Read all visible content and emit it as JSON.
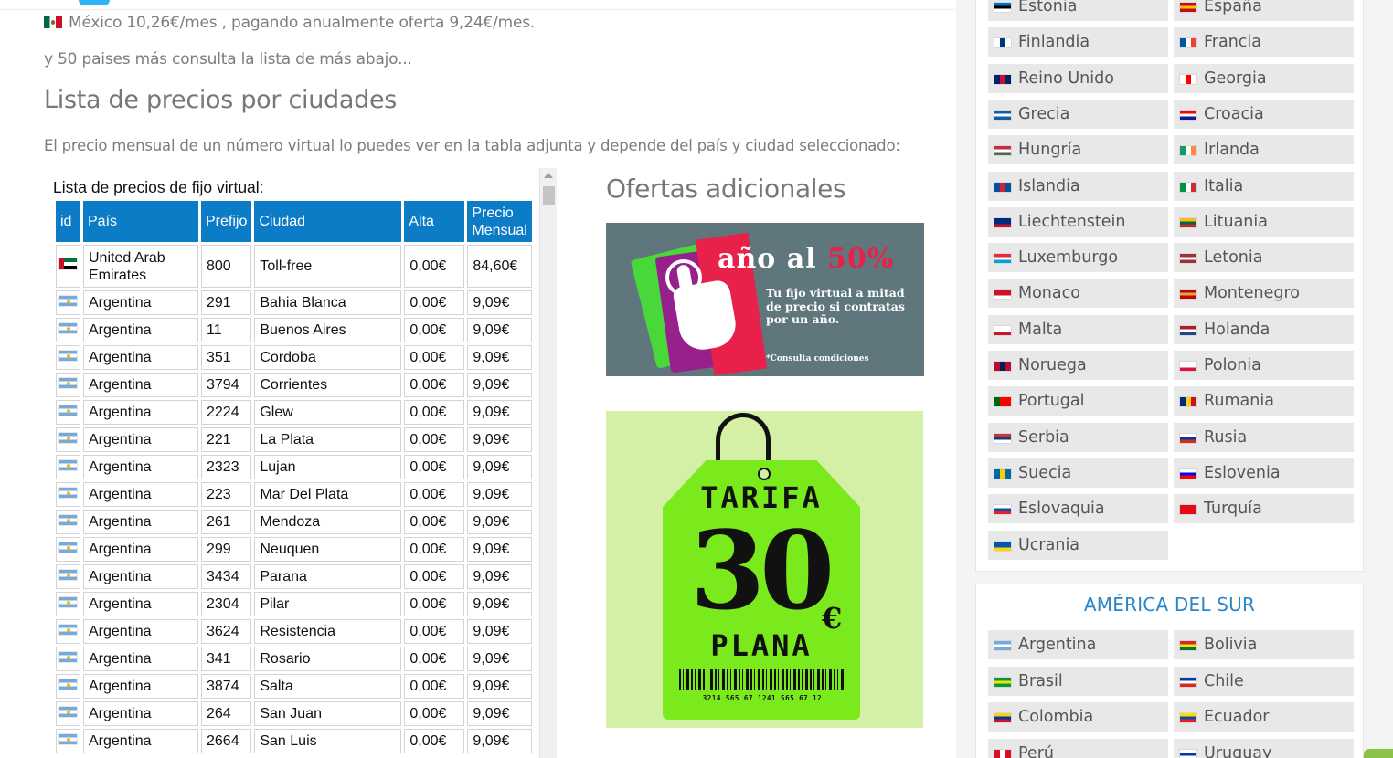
{
  "intro": {
    "mexico_line": "México 10,26€/mes , pagando anualmente oferta 9,24€/mes.",
    "more_countries": "y 50 paises más consulta la lista de más abajo..."
  },
  "section": {
    "title": "Lista de precios por ciudades",
    "description": "El precio mensual de un número virtual lo puedes ver en la tabla adjunta y depende del país y ciudad seleccionado:"
  },
  "price_table": {
    "title": "Lista de precios de fijo virtual:",
    "headers": {
      "id": "id",
      "pais": "País",
      "prefijo": "Prefijo",
      "ciudad": "Ciudad",
      "alta": "Alta",
      "precio_mensual": "Precio Mensual"
    },
    "rows": [
      {
        "flag": "uae-flag",
        "pais": "United Arab Emirates",
        "prefijo": "800",
        "ciudad": "Toll-free",
        "alta": "0,00€",
        "precio": "84,60€"
      },
      {
        "flag": "argentina-flag",
        "pais": "Argentina",
        "prefijo": "291",
        "ciudad": "Bahia Blanca",
        "alta": "0,00€",
        "precio": "9,09€"
      },
      {
        "flag": "argentina-flag",
        "pais": "Argentina",
        "prefijo": "11",
        "ciudad": "Buenos Aires",
        "alta": "0,00€",
        "precio": "9,09€"
      },
      {
        "flag": "argentina-flag",
        "pais": "Argentina",
        "prefijo": "351",
        "ciudad": "Cordoba",
        "alta": "0,00€",
        "precio": "9,09€"
      },
      {
        "flag": "argentina-flag",
        "pais": "Argentina",
        "prefijo": "3794",
        "ciudad": "Corrientes",
        "alta": "0,00€",
        "precio": "9,09€"
      },
      {
        "flag": "argentina-flag",
        "pais": "Argentina",
        "prefijo": "2224",
        "ciudad": "Glew",
        "alta": "0,00€",
        "precio": "9,09€"
      },
      {
        "flag": "argentina-flag",
        "pais": "Argentina",
        "prefijo": "221",
        "ciudad": "La Plata",
        "alta": "0,00€",
        "precio": "9,09€"
      },
      {
        "flag": "argentina-flag",
        "pais": "Argentina",
        "prefijo": "2323",
        "ciudad": "Lujan",
        "alta": "0,00€",
        "precio": "9,09€"
      },
      {
        "flag": "argentina-flag",
        "pais": "Argentina",
        "prefijo": "223",
        "ciudad": "Mar Del Plata",
        "alta": "0,00€",
        "precio": "9,09€"
      },
      {
        "flag": "argentina-flag",
        "pais": "Argentina",
        "prefijo": "261",
        "ciudad": "Mendoza",
        "alta": "0,00€",
        "precio": "9,09€"
      },
      {
        "flag": "argentina-flag",
        "pais": "Argentina",
        "prefijo": "299",
        "ciudad": "Neuquen",
        "alta": "0,00€",
        "precio": "9,09€"
      },
      {
        "flag": "argentina-flag",
        "pais": "Argentina",
        "prefijo": "3434",
        "ciudad": "Parana",
        "alta": "0,00€",
        "precio": "9,09€"
      },
      {
        "flag": "argentina-flag",
        "pais": "Argentina",
        "prefijo": "2304",
        "ciudad": "Pilar",
        "alta": "0,00€",
        "precio": "9,09€"
      },
      {
        "flag": "argentina-flag",
        "pais": "Argentina",
        "prefijo": "3624",
        "ciudad": "Resistencia",
        "alta": "0,00€",
        "precio": "9,09€"
      },
      {
        "flag": "argentina-flag",
        "pais": "Argentina",
        "prefijo": "341",
        "ciudad": "Rosario",
        "alta": "0,00€",
        "precio": "9,09€"
      },
      {
        "flag": "argentina-flag",
        "pais": "Argentina",
        "prefijo": "3874",
        "ciudad": "Salta",
        "alta": "0,00€",
        "precio": "9,09€"
      },
      {
        "flag": "argentina-flag",
        "pais": "Argentina",
        "prefijo": "264",
        "ciudad": "San Juan",
        "alta": "0,00€",
        "precio": "9,09€"
      },
      {
        "flag": "argentina-flag",
        "pais": "Argentina",
        "prefijo": "2664",
        "ciudad": "San Luis",
        "alta": "0,00€",
        "precio": "9,09€"
      }
    ]
  },
  "offers": {
    "title": "Ofertas adicionales",
    "banner_half_year": {
      "headline_part1": "año al ",
      "headline_part2": "50%",
      "subtitle": "Tu fijo virtual a mitad de precio si contratas por un año.",
      "note": "*Consulta condiciones"
    },
    "banner_flat_rate": {
      "top": "TARIFA",
      "amount": "30",
      "currency": "€",
      "bottom": "PLANA",
      "barcode_digits": "3214 565 67 1241 565 67 12"
    }
  },
  "sidebar": {
    "europe_countries": [
      {
        "name": "Estonia",
        "flag": "estonia-flag",
        "colors": [
          "#0072ce",
          "#000000",
          "#ffffff"
        ]
      },
      {
        "name": "España",
        "flag": "spain-flag",
        "colors": [
          "#c60b1e",
          "#ffc400",
          "#c60b1e"
        ]
      },
      {
        "name": "Finlandia",
        "flag": "finland-flag",
        "colors": [
          "#ffffff",
          "#003580",
          "#ffffff"
        ]
      },
      {
        "name": "Francia",
        "flag": "france-flag",
        "colors": [
          "#0055a4",
          "#ffffff",
          "#ef4135"
        ]
      },
      {
        "name": "Reino Unido",
        "flag": "uk-flag",
        "colors": [
          "#012169",
          "#c8102e",
          "#012169"
        ]
      },
      {
        "name": "Georgia",
        "flag": "georgia-flag",
        "colors": [
          "#ffffff",
          "#ff0000",
          "#ffffff"
        ]
      },
      {
        "name": "Grecia",
        "flag": "greece-flag",
        "colors": [
          "#0d5eaf",
          "#ffffff",
          "#0d5eaf"
        ]
      },
      {
        "name": "Croacia",
        "flag": "croatia-flag",
        "colors": [
          "#ff0000",
          "#ffffff",
          "#171796"
        ]
      },
      {
        "name": "Hungría",
        "flag": "hungary-flag",
        "colors": [
          "#cd2a3e",
          "#ffffff",
          "#436f4d"
        ]
      },
      {
        "name": "Irlanda",
        "flag": "ireland-flag",
        "colors": [
          "#169b62",
          "#ffffff",
          "#ff883e"
        ]
      },
      {
        "name": "Islandia",
        "flag": "iceland-flag",
        "colors": [
          "#02529c",
          "#dc1e35",
          "#02529c"
        ]
      },
      {
        "name": "Italia",
        "flag": "italy-flag",
        "colors": [
          "#009246",
          "#ffffff",
          "#ce2b37"
        ]
      },
      {
        "name": "Liechtenstein",
        "flag": "liechtenstein-flag",
        "colors": [
          "#002b7f",
          "#002b7f",
          "#ce1126"
        ]
      },
      {
        "name": "Lituania",
        "flag": "lithuania-flag",
        "colors": [
          "#fdb913",
          "#006a44",
          "#c1272d"
        ]
      },
      {
        "name": "Luxemburgo",
        "flag": "luxembourg-flag",
        "colors": [
          "#ed2939",
          "#ffffff",
          "#00a1de"
        ]
      },
      {
        "name": "Letonia",
        "flag": "latvia-flag",
        "colors": [
          "#9e3039",
          "#ffffff",
          "#9e3039"
        ]
      },
      {
        "name": "Monaco",
        "flag": "monaco-flag",
        "colors": [
          "#ce1126",
          "#ce1126",
          "#ffffff"
        ]
      },
      {
        "name": "Montenegro",
        "flag": "montenegro-flag",
        "colors": [
          "#c40308",
          "#d4af37",
          "#c40308"
        ]
      },
      {
        "name": "Malta",
        "flag": "malta-flag",
        "colors": [
          "#ffffff",
          "#ffffff",
          "#cf142b"
        ]
      },
      {
        "name": "Holanda",
        "flag": "netherlands-flag",
        "colors": [
          "#ae1c28",
          "#ffffff",
          "#21468b"
        ]
      },
      {
        "name": "Noruega",
        "flag": "norway-flag",
        "colors": [
          "#ba0c2f",
          "#00205b",
          "#ba0c2f"
        ]
      },
      {
        "name": "Polonia",
        "flag": "poland-flag",
        "colors": [
          "#ffffff",
          "#ffffff",
          "#dc143c"
        ]
      },
      {
        "name": "Portugal",
        "flag": "portugal-flag",
        "colors": [
          "#006600",
          "#ff0000",
          "#ff0000"
        ]
      },
      {
        "name": "Rumania",
        "flag": "romania-flag",
        "colors": [
          "#002b7f",
          "#fcd116",
          "#ce1126"
        ]
      },
      {
        "name": "Serbia",
        "flag": "serbia-flag",
        "colors": [
          "#c6363c",
          "#0c4076",
          "#ffffff"
        ]
      },
      {
        "name": "Rusia",
        "flag": "russia-flag",
        "colors": [
          "#ffffff",
          "#0039a6",
          "#d52b1e"
        ]
      },
      {
        "name": "Suecia",
        "flag": "sweden-flag",
        "colors": [
          "#006aa7",
          "#fecc00",
          "#006aa7"
        ]
      },
      {
        "name": "Eslovenia",
        "flag": "slovenia-flag",
        "colors": [
          "#ffffff",
          "#0000ff",
          "#ff0000"
        ]
      },
      {
        "name": "Eslovaquia",
        "flag": "slovakia-flag",
        "colors": [
          "#ffffff",
          "#0b4ea2",
          "#ee1c25"
        ]
      },
      {
        "name": "Turquía",
        "flag": "turkey-flag",
        "colors": [
          "#e30a17",
          "#e30a17",
          "#e30a17"
        ]
      },
      {
        "name": "Ucrania",
        "flag": "ukraine-flag",
        "colors": [
          "#0057b7",
          "#0057b7",
          "#ffd700"
        ]
      }
    ],
    "south_america_title": "AMÉRICA DEL SUR",
    "south_america_countries": [
      {
        "name": "Argentina",
        "flag": "argentina-flag",
        "colors": [
          "#75aadb",
          "#ffffff",
          "#75aadb"
        ]
      },
      {
        "name": "Bolivia",
        "flag": "bolivia-flag",
        "colors": [
          "#d52b1e",
          "#f9e300",
          "#007934"
        ]
      },
      {
        "name": "Brasil",
        "flag": "brazil-flag",
        "colors": [
          "#009c3b",
          "#ffdf00",
          "#009c3b"
        ]
      },
      {
        "name": "Chile",
        "flag": "chile-flag",
        "colors": [
          "#0039a6",
          "#ffffff",
          "#d52b1e"
        ]
      },
      {
        "name": "Colombia",
        "flag": "colombia-flag",
        "colors": [
          "#fcd116",
          "#003893",
          "#ce1126"
        ]
      },
      {
        "name": "Ecuador",
        "flag": "ecuador-flag",
        "colors": [
          "#ffdd00",
          "#034ea2",
          "#ed1c24"
        ]
      },
      {
        "name": "Perú",
        "flag": "peru-flag",
        "colors": [
          "#d91023",
          "#ffffff",
          "#d91023"
        ]
      },
      {
        "name": "Uruguay",
        "flag": "uruguay-flag",
        "colors": [
          "#ffffff",
          "#0038a8",
          "#ffffff"
        ]
      }
    ]
  }
}
